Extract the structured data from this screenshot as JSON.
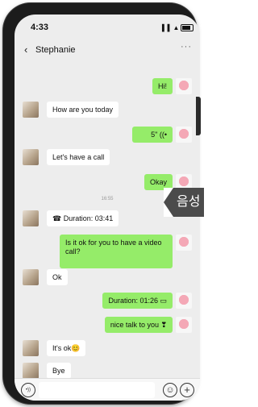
{
  "status": {
    "time": "4:33",
    "signal": "▐▐ ▲"
  },
  "header": {
    "back_icon": "‹",
    "contact_name": "Stephanie",
    "more_icon": "···"
  },
  "messages": [
    {
      "side": "right",
      "text": "Hi!"
    },
    {
      "side": "left",
      "text": "How are you today"
    },
    {
      "side": "right",
      "text": "5\" ((•"
    },
    {
      "side": "left",
      "text": "Let's have a call"
    },
    {
      "side": "right",
      "text": "Okay"
    },
    {
      "side": "left",
      "text": "☎ Duration: 03:41"
    },
    {
      "side": "right",
      "text": "Is it ok for you to have a video call?"
    },
    {
      "side": "left",
      "text": "Ok"
    },
    {
      "side": "right",
      "text": "Duration: 01:26 ▭"
    },
    {
      "side": "right",
      "text": "nice talk to you ❣"
    },
    {
      "side": "left",
      "text": "It's ok😊"
    },
    {
      "side": "left",
      "text": "Bye"
    }
  ],
  "timestamp": "16:55",
  "input": {
    "voice_icon": "•))",
    "emoji_icon": "☺",
    "plus_icon": "+"
  },
  "callout_text": "음성",
  "colors": {
    "sent_bubble": "#95ec69",
    "received_bubble": "#ffffff",
    "background": "#ededed"
  }
}
